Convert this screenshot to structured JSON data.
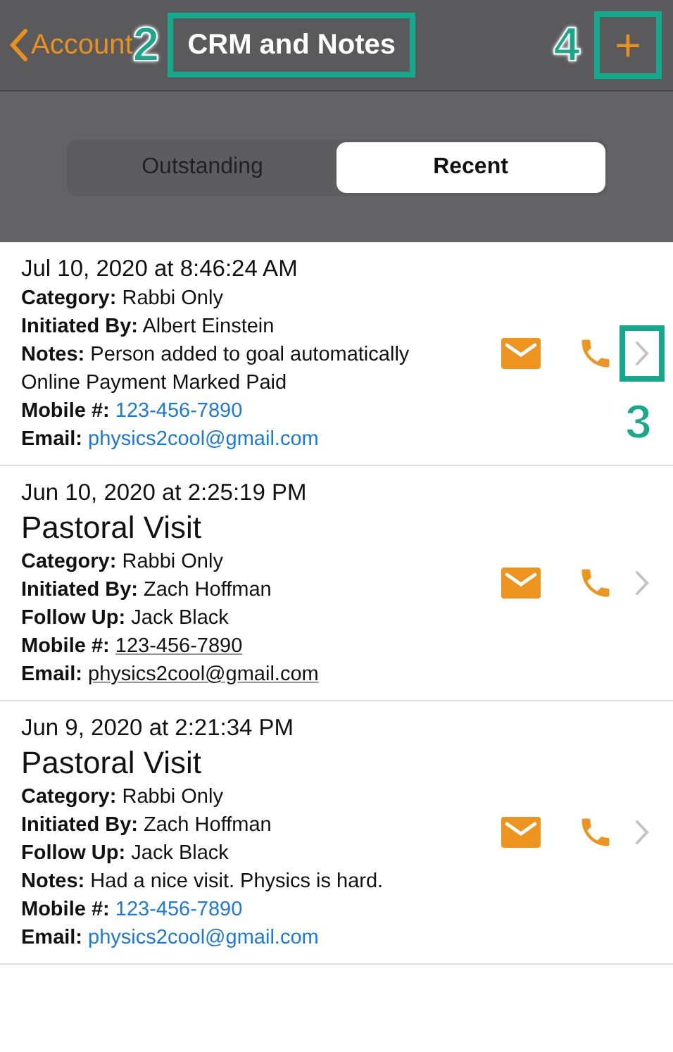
{
  "nav": {
    "back": "Account",
    "title": {
      "text": "CRM and Notes",
      "callout": "2"
    },
    "add_button": {
      "text": "+",
      "callout": "4"
    }
  },
  "segments": [
    {
      "label": "Outstanding",
      "selected": false
    },
    {
      "label": "Recent",
      "selected": true
    }
  ],
  "entries": [
    {
      "date": "Jul 10, 2020 at 8:46:24 AM",
      "chevron_callout": "3",
      "fields": [
        {
          "kind": "text",
          "label": "Category:",
          "value": "Rabbi Only"
        },
        {
          "kind": "text",
          "label": "Initiated By:",
          "value": "Albert Einstein"
        },
        {
          "kind": "text",
          "label": "Notes:",
          "value": "Person added to goal automatically"
        },
        {
          "kind": "line",
          "value": "Online Payment Marked Paid"
        },
        {
          "kind": "link",
          "label": "Mobile #:",
          "value": "123-456-7890"
        },
        {
          "kind": "link",
          "label": "Email:",
          "value": "physics2cool@gmail.com"
        }
      ]
    },
    {
      "date": "Jun 10, 2020 at 2:25:19 PM",
      "title": "Pastoral Visit",
      "fields": [
        {
          "kind": "text",
          "label": "Category:",
          "value": "Rabbi Only"
        },
        {
          "kind": "text",
          "label": "Initiated By:",
          "value": "Zach Hoffman"
        },
        {
          "kind": "text",
          "label": "Follow Up:",
          "value": "Jack Black"
        },
        {
          "kind": "underlined",
          "label": "Mobile #:",
          "value": "123-456-7890"
        },
        {
          "kind": "underlined",
          "label": "Email:",
          "value": "physics2cool@gmail.com"
        }
      ]
    },
    {
      "date": "Jun 9, 2020 at 2:21:34 PM",
      "title": "Pastoral Visit",
      "fields": [
        {
          "kind": "text",
          "label": "Category:",
          "value": "Rabbi Only"
        },
        {
          "kind": "text",
          "label": "Initiated By:",
          "value": "Zach Hoffman"
        },
        {
          "kind": "text",
          "label": "Follow Up:",
          "value": "Jack Black"
        },
        {
          "kind": "text",
          "label": "Notes:",
          "value": "Had a nice visit. Physics is hard."
        },
        {
          "kind": "link",
          "label": "Mobile #:",
          "value": "123-456-7890"
        },
        {
          "kind": "link",
          "label": "Email:",
          "value": "physics2cool@gmail.com"
        }
      ]
    }
  ]
}
